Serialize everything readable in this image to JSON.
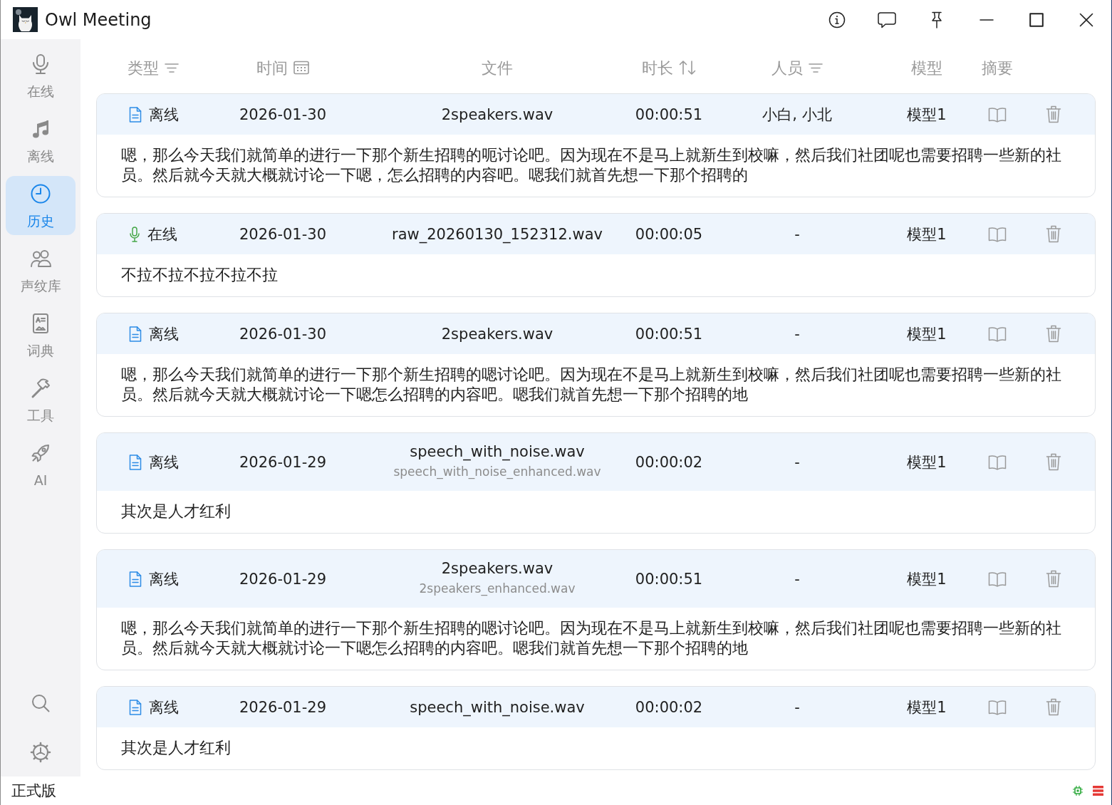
{
  "window": {
    "title": "Owl Meeting"
  },
  "sidebar": {
    "items": [
      {
        "label": "在线",
        "selected": false
      },
      {
        "label": "离线",
        "selected": false
      },
      {
        "label": "历史",
        "selected": true
      },
      {
        "label": "声纹库",
        "selected": false
      },
      {
        "label": "词典",
        "selected": false
      },
      {
        "label": "工具",
        "selected": false
      },
      {
        "label": "AI",
        "selected": false
      }
    ]
  },
  "table": {
    "columns": [
      "类型",
      "时间",
      "文件",
      "时长",
      "人员",
      "模型",
      "摘要"
    ],
    "rows": [
      {
        "kind": "offline",
        "type": "离线",
        "date": "2026-01-30",
        "file": "2speakers.wav",
        "duration": "00:00:51",
        "speakers": "小白, 小北",
        "model": "模型1",
        "transcript": "嗯，那么今天我们就简单的进行一下那个新生招聘的呃讨论吧。因为现在不是马上就新生到校嘛，然后我们社团呢也需要招聘一些新的社员。然后就今天就大概就讨论一下嗯，怎么招聘的内容吧。嗯我们就首先想一下那个招聘的"
      },
      {
        "kind": "online",
        "type": "在线",
        "date": "2026-01-30",
        "file": "raw_20260130_152312.wav",
        "duration": "00:00:05",
        "speakers": "-",
        "model": "模型1",
        "transcript": "不拉不拉不拉不拉不拉"
      },
      {
        "kind": "offline",
        "type": "离线",
        "date": "2026-01-30",
        "file": "2speakers.wav",
        "duration": "00:00:51",
        "speakers": "-",
        "model": "模型1",
        "transcript": "嗯，那么今天我们就简单的进行一下那个新生招聘的嗯讨论吧。因为现在不是马上就新生到校嘛，然后我们社团呢也需要招聘一些新的社员。然后就今天就大概就讨论一下嗯怎么招聘的内容吧。嗯我们就首先想一下那个招聘的地"
      },
      {
        "kind": "offline",
        "type": "离线",
        "date": "2026-01-29",
        "file": "speech_with_noise.wav",
        "enhanced_file": "speech_with_noise_enhanced.wav",
        "duration": "00:00:02",
        "speakers": "-",
        "model": "模型1",
        "transcript": "其次是人才红利"
      },
      {
        "kind": "offline",
        "type": "离线",
        "date": "2026-01-29",
        "file": "2speakers.wav",
        "enhanced_file": "2speakers_enhanced.wav",
        "duration": "00:00:51",
        "speakers": "-",
        "model": "模型1",
        "transcript": "嗯，那么今天我们就简单的进行一下那个新生招聘的嗯讨论吧。因为现在不是马上就新生到校嘛，然后我们社团呢也需要招聘一些新的社员。然后就今天就大概就讨论一下嗯怎么招聘的内容吧。嗯我们就首先想一下那个招聘的地"
      },
      {
        "kind": "offline",
        "type": "离线",
        "date": "2026-01-29",
        "file": "speech_with_noise.wav",
        "duration": "00:00:02",
        "speakers": "-",
        "model": "模型1",
        "transcript": "其次是人才红利"
      }
    ]
  },
  "status_bar": {
    "edition": "正式版"
  }
}
